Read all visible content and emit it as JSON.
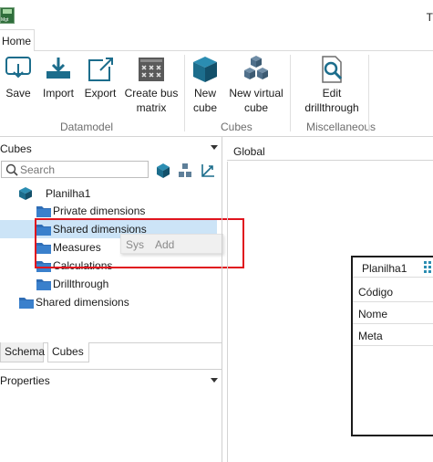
{
  "window": {
    "title_fragment": "T",
    "app_icon_text": "Mgt"
  },
  "ribbon": {
    "tabs": [
      {
        "label": "Home"
      }
    ],
    "buttons": {
      "save": "Save",
      "import": "Import",
      "export": "Export",
      "create_bus_matrix": [
        "Create bus",
        "matrix"
      ],
      "new_cube": [
        "New",
        "cube"
      ],
      "new_virtual_cube": [
        "New virtual",
        "cube"
      ],
      "edit_drillthrough": [
        "Edit",
        "drillthrough"
      ]
    },
    "groups": {
      "datamodel": "Datamodel",
      "cubes": "Cubes",
      "miscellaneous": "Miscellaneous"
    }
  },
  "left_panel": {
    "header": "Cubes",
    "search": {
      "placeholder": "Search",
      "value": ""
    },
    "tree": [
      {
        "label": "Planilha1",
        "type": "cube"
      },
      {
        "label": "Private dimensions",
        "type": "folder"
      },
      {
        "label": "Shared dimensions",
        "type": "folder",
        "selected": true
      },
      {
        "label": "Measures",
        "type": "folder"
      },
      {
        "label": "Calculations",
        "type": "folder"
      },
      {
        "label": "Drillthrough",
        "type": "folder"
      },
      {
        "label": "Shared dimensions",
        "type": "folder"
      }
    ],
    "context_menu": {
      "items": [
        "Sys",
        "Add"
      ]
    },
    "bottom_tabs": [
      "Schema",
      "Cubes"
    ],
    "properties_header": "Properties"
  },
  "canvas": {
    "tab": "Global",
    "entity": {
      "title": "Planilha1",
      "rows": [
        "Código",
        "Nome",
        "Meta"
      ]
    }
  },
  "colors": {
    "folder_blue": "#2f6db5",
    "cube_teal": "#1c6d8c",
    "highlight_red": "#e0141e",
    "selection_blue": "#cce4f7"
  }
}
